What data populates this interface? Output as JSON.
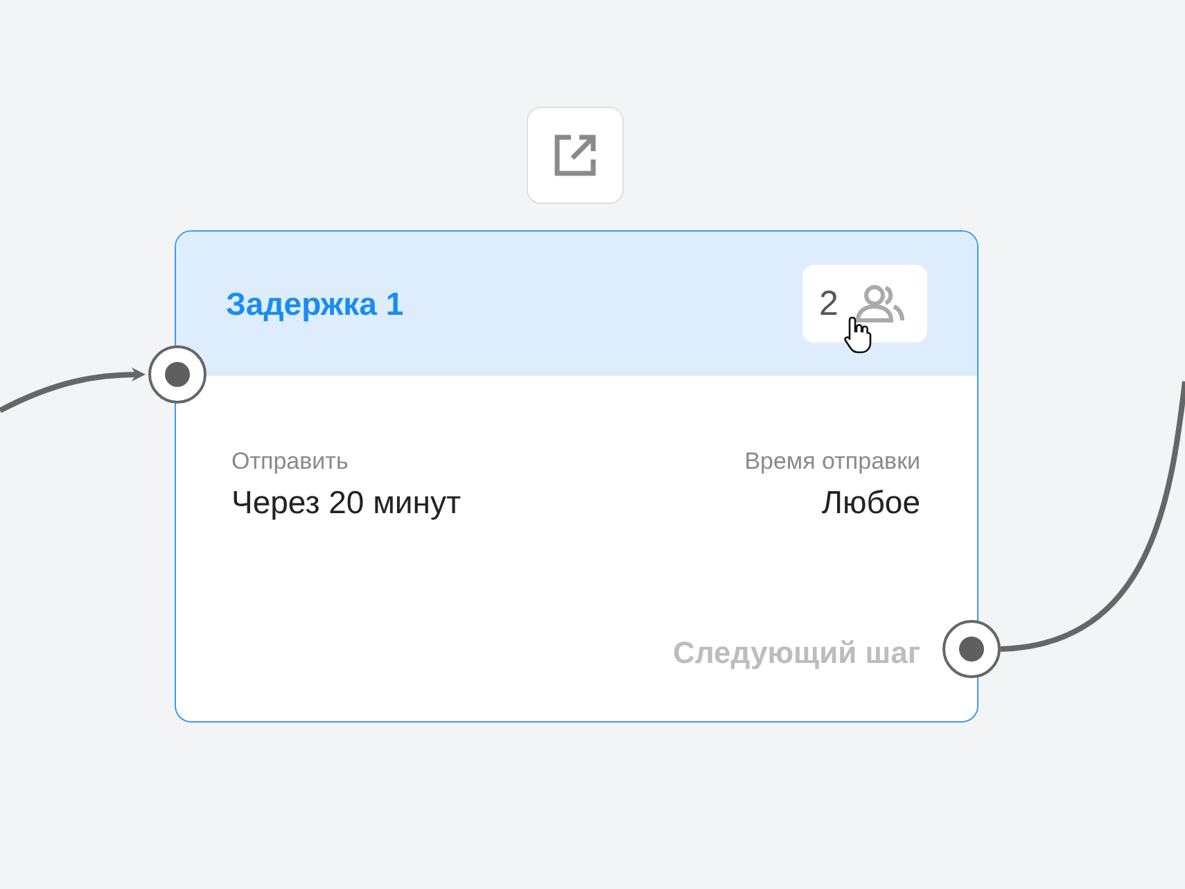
{
  "node": {
    "title": "Задержка 1",
    "recipients_count": "2",
    "fields": [
      {
        "label": "Отправить",
        "value": "Через 20 минут"
      },
      {
        "label": "Время отправки",
        "value": "Любое"
      }
    ],
    "next_step": "Следующий шаг"
  }
}
